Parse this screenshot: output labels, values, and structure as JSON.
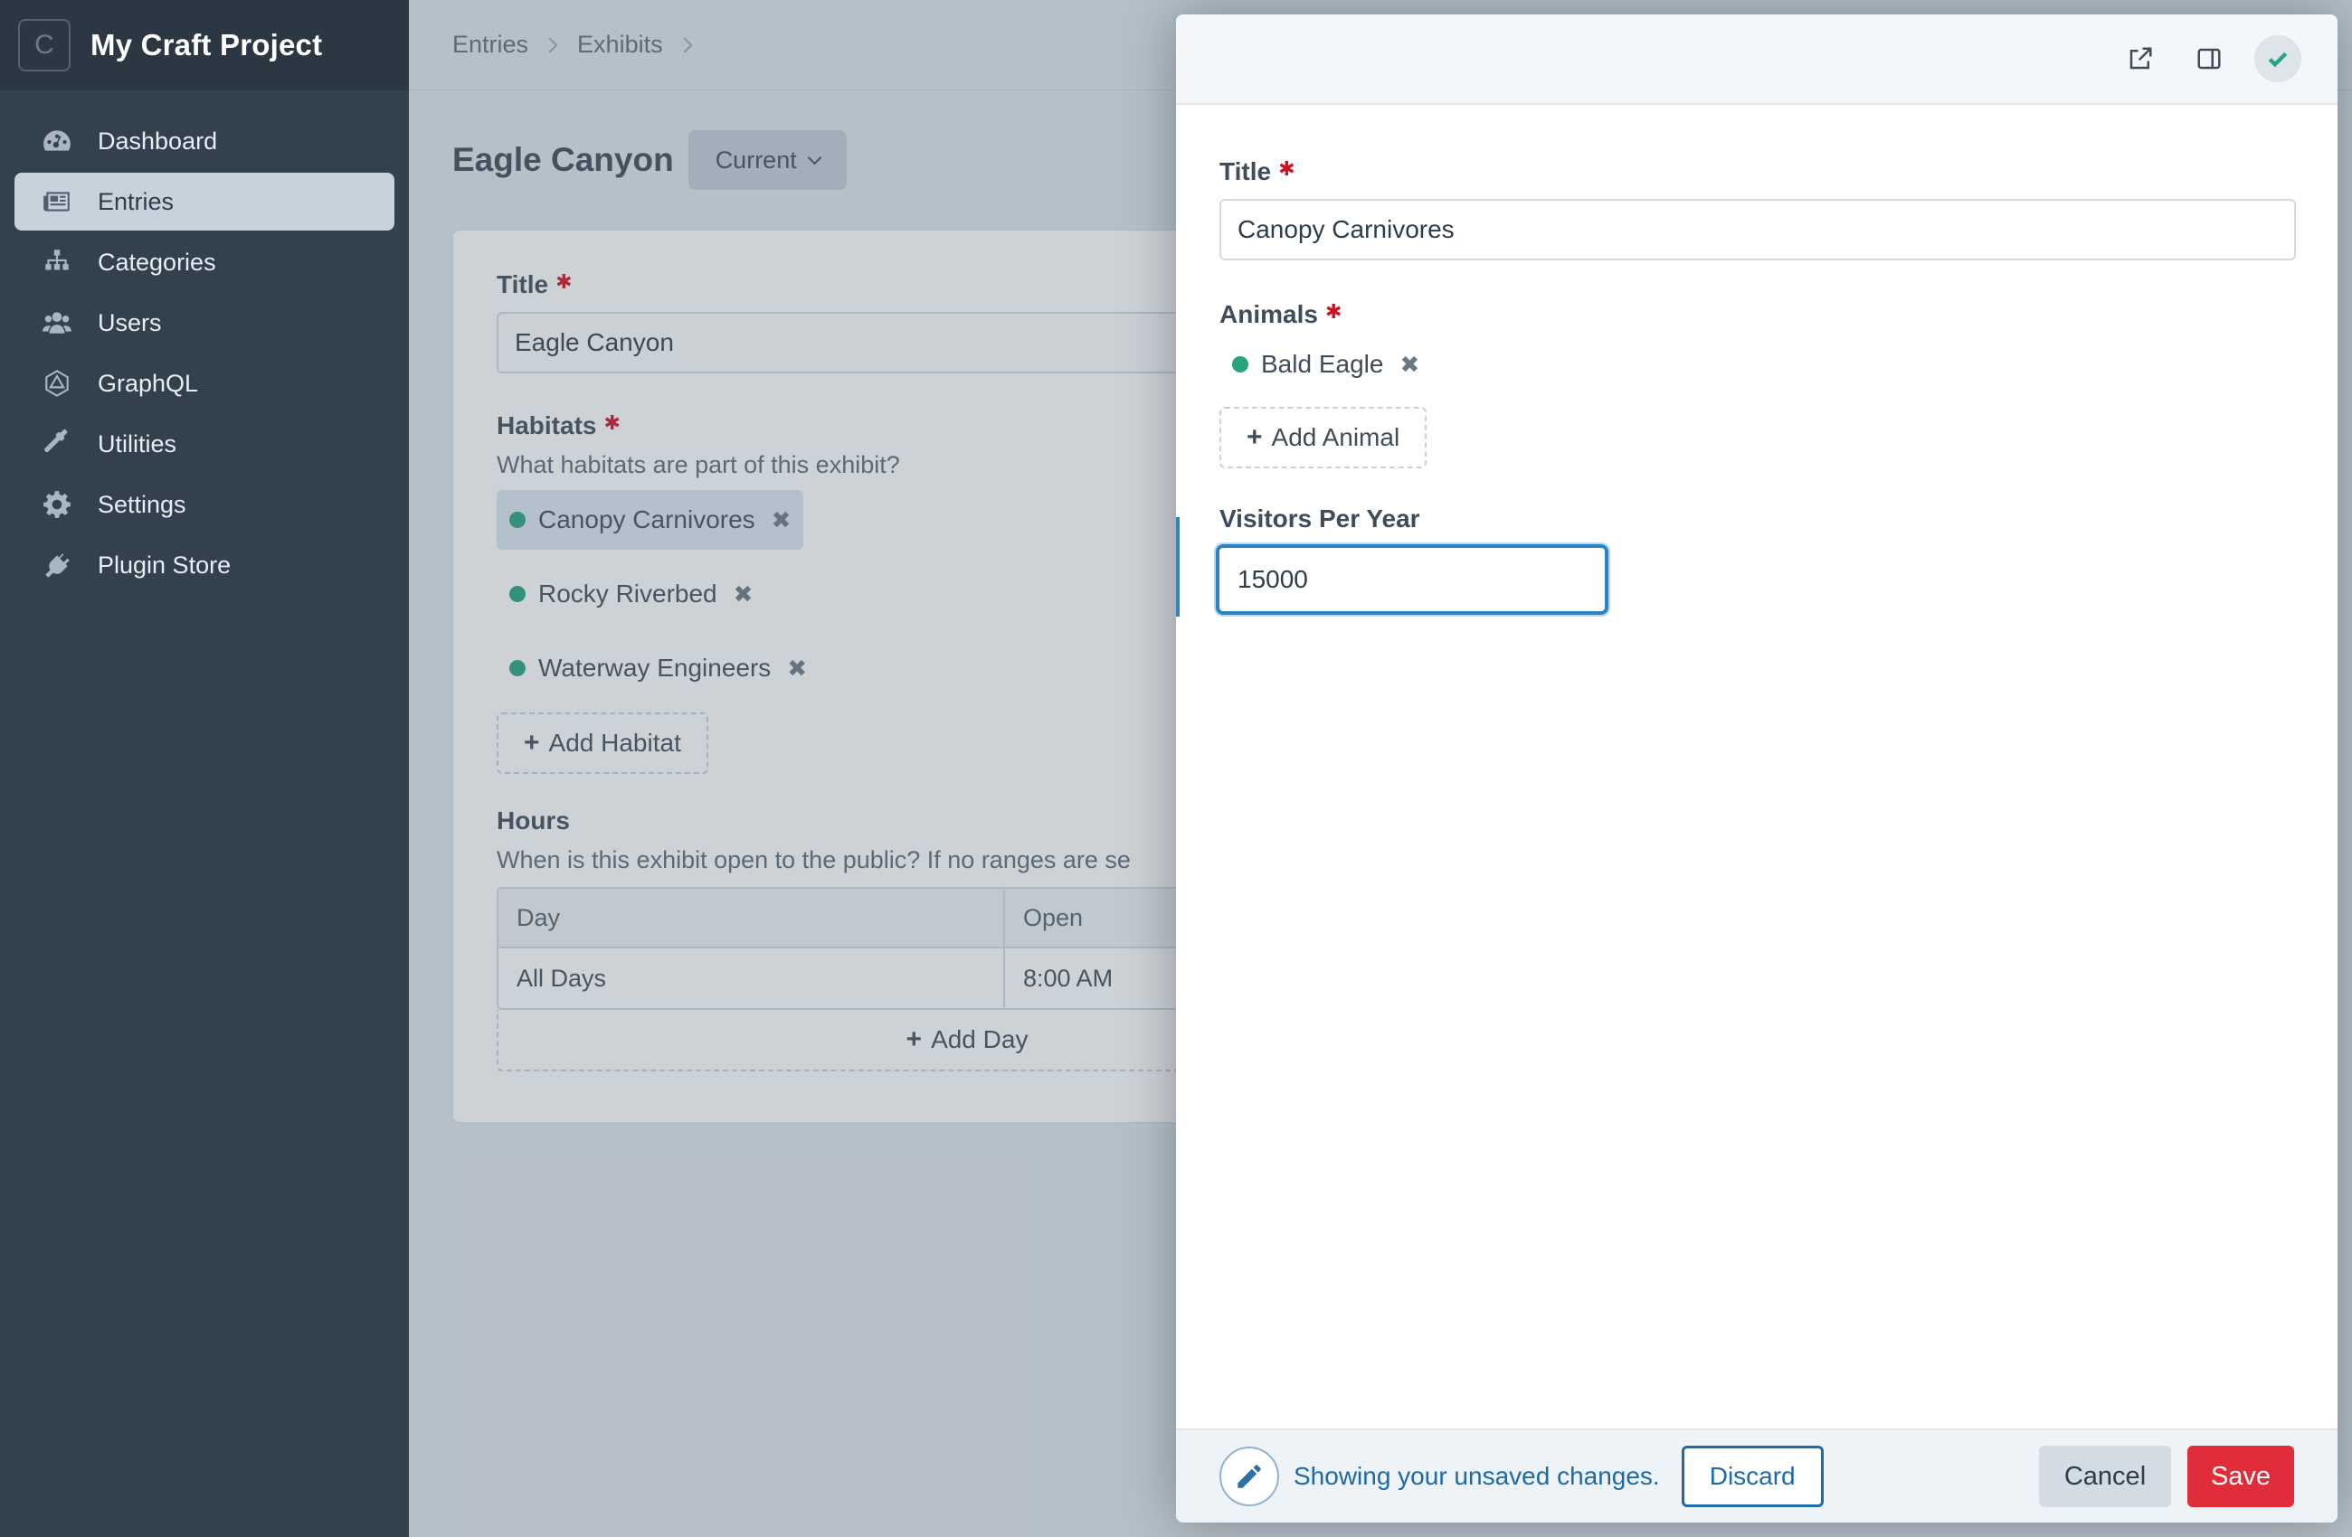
{
  "sidebar": {
    "logo_letter": "C",
    "site_name": "My Craft Project",
    "items": [
      {
        "label": "Dashboard",
        "icon": "gauge-icon"
      },
      {
        "label": "Entries",
        "icon": "newspaper-icon",
        "active": true
      },
      {
        "label": "Categories",
        "icon": "sitemap-icon"
      },
      {
        "label": "Users",
        "icon": "users-icon"
      },
      {
        "label": "GraphQL",
        "icon": "graphql-icon"
      },
      {
        "label": "Utilities",
        "icon": "wrench-icon"
      },
      {
        "label": "Settings",
        "icon": "gear-icon"
      },
      {
        "label": "Plugin Store",
        "icon": "plug-icon"
      }
    ]
  },
  "breadcrumb": {
    "items": [
      "Entries",
      "Exhibits"
    ]
  },
  "page": {
    "title": "Eagle Canyon",
    "revision_label": "Current"
  },
  "entry_form": {
    "title_label": "Title",
    "title_value": "Eagle Canyon",
    "habitats_label": "Habitats",
    "habitats_instructions": "What habitats are part of this exhibit?",
    "habitats": [
      "Canopy Carnivores",
      "Rocky Riverbed",
      "Waterway Engineers"
    ],
    "add_habitat_label": "Add Habitat",
    "hours_label": "Hours",
    "hours_instructions": "When is this exhibit open to the public? If no ranges are se",
    "hours_table": {
      "columns": [
        "Day",
        "Open"
      ],
      "rows": [
        [
          "All Days",
          "8:00 AM"
        ]
      ]
    },
    "add_day_label": "Add Day"
  },
  "slideout": {
    "title_label": "Title",
    "title_value": "Canopy Carnivores",
    "animals_label": "Animals",
    "animals": [
      "Bald Eagle"
    ],
    "add_animal_label": "Add Animal",
    "visitors_label": "Visitors Per Year",
    "visitors_value": "15000",
    "footer": {
      "notice": "Showing your unsaved changes.",
      "discard_label": "Discard",
      "cancel_label": "Cancel",
      "save_label": "Save"
    }
  },
  "colors": {
    "sidebar_bg": "#33404d",
    "accent_blue": "#1e6aa6",
    "save_red": "#e12d39",
    "status_green": "#27a37e",
    "required_red": "#cf1124"
  }
}
